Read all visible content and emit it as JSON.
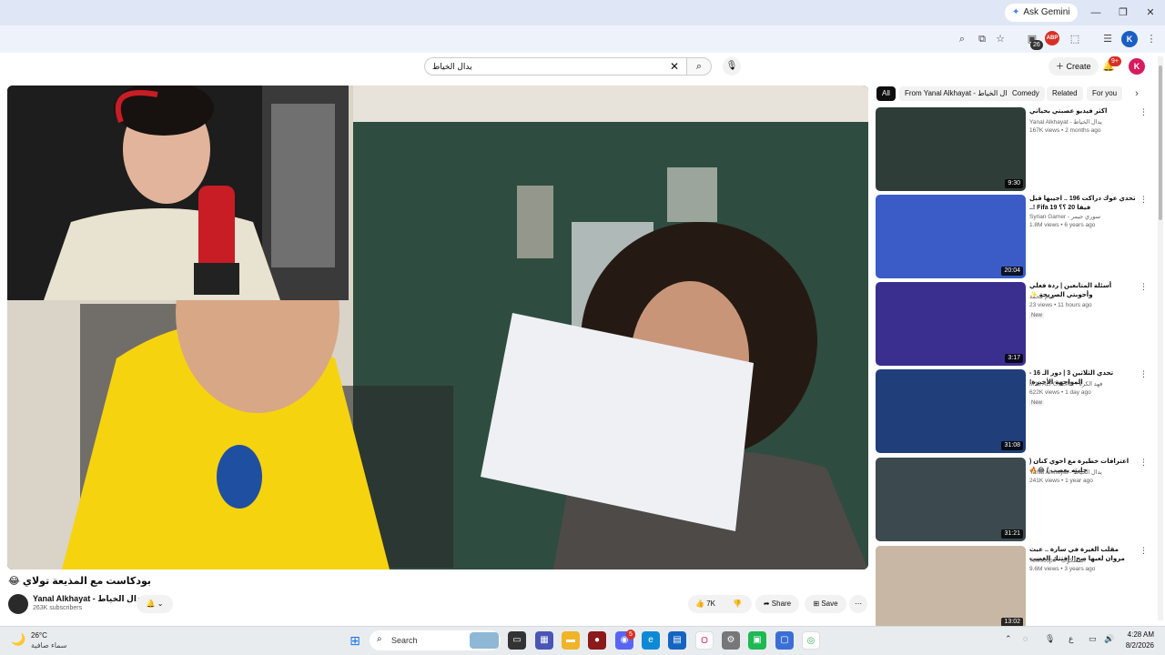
{
  "browser": {
    "ask_gemini": "Ask Gemini",
    "profile_letter": "K",
    "abp_badge": "ABP",
    "ext_badge": "26"
  },
  "youtube": {
    "search_value": "يدال الخياط",
    "create_label": "Create",
    "notif_count": "9+",
    "avatar_letter": "K"
  },
  "video": {
    "title": "بودكاست مع المذيعة تولاي 😂",
    "channel": "Yanal Alkhayat - يدال الخياط",
    "subscribers": "263K subscribers",
    "likes": "7K",
    "share": "Share",
    "save": "Save"
  },
  "chips": [
    "All",
    "From Yanal Alkhayat - يدال الخياط",
    "Comedy",
    "Related",
    "For you"
  ],
  "recommendations": [
    {
      "title": "اكثر فيديو عصبني بحياتي",
      "channel": "Yanal Alkhayat - يدال الخياط",
      "meta": "167K views • 2 months ago",
      "duration": "9:30",
      "new": "",
      "thumb_color": "#2f3d38"
    },
    {
      "title": "تحدي عوك دراكت 196 .. اجيبها قبل فيفا 20 ؟؟ Fifa 19 !..",
      "channel": "Syrian Gamer - سوري جيمر",
      "meta": "1.8M views • 6 years ago",
      "duration": "20:04",
      "new": "",
      "thumb_color": "#3b5cc7"
    },
    {
      "title": "أسئلة المتابعين | ردة فعلي وأجوبتي الصريحة ✨",
      "channel": "فيام محمد",
      "meta": "23 views • 11 hours ago",
      "duration": "3:17",
      "new": "New",
      "thumb_color": "#3a2f8f"
    },
    {
      "title": "تحدي الثلاثين 3 | دور الـ 16 - المواجهة الأخيرة!",
      "channel": "M12 ALFOUZAN - فهد الكرة",
      "meta": "622K views • 1 day ago",
      "duration": "31:08",
      "new": "New",
      "thumb_color": "#1f3e7a"
    },
    {
      "title": "اعترافات خطيرة مع اخوي كنان ( خليته يعصب ) 😂🔥",
      "channel": "Yanal Alkhayat - يدال الخياط",
      "meta": "241K views • 1 year ago",
      "duration": "31:21",
      "new": "",
      "thumb_color": "#3c4a4f"
    },
    {
      "title": "مقلب الغيرة في سارة .. عبث مروان لعبها صح!! افتتك الغضب",
      "channel": "Telescope - التلسكوب",
      "meta": "9.6M views • 3 years ago",
      "duration": "13:02",
      "new": "",
      "thumb_color": "#c9b7a6"
    }
  ],
  "taskbar": {
    "temp": "26°C",
    "weather": "سماء صافية",
    "search_placeholder": "Search",
    "time": "4:28 AM",
    "date": "8/2/2026",
    "lang": "ع",
    "discord_badge": "5"
  },
  "colors": {
    "accent_red": "#ff0000",
    "avatar_blue": "#1a5fc2",
    "avatar_red": "#d81b60"
  }
}
